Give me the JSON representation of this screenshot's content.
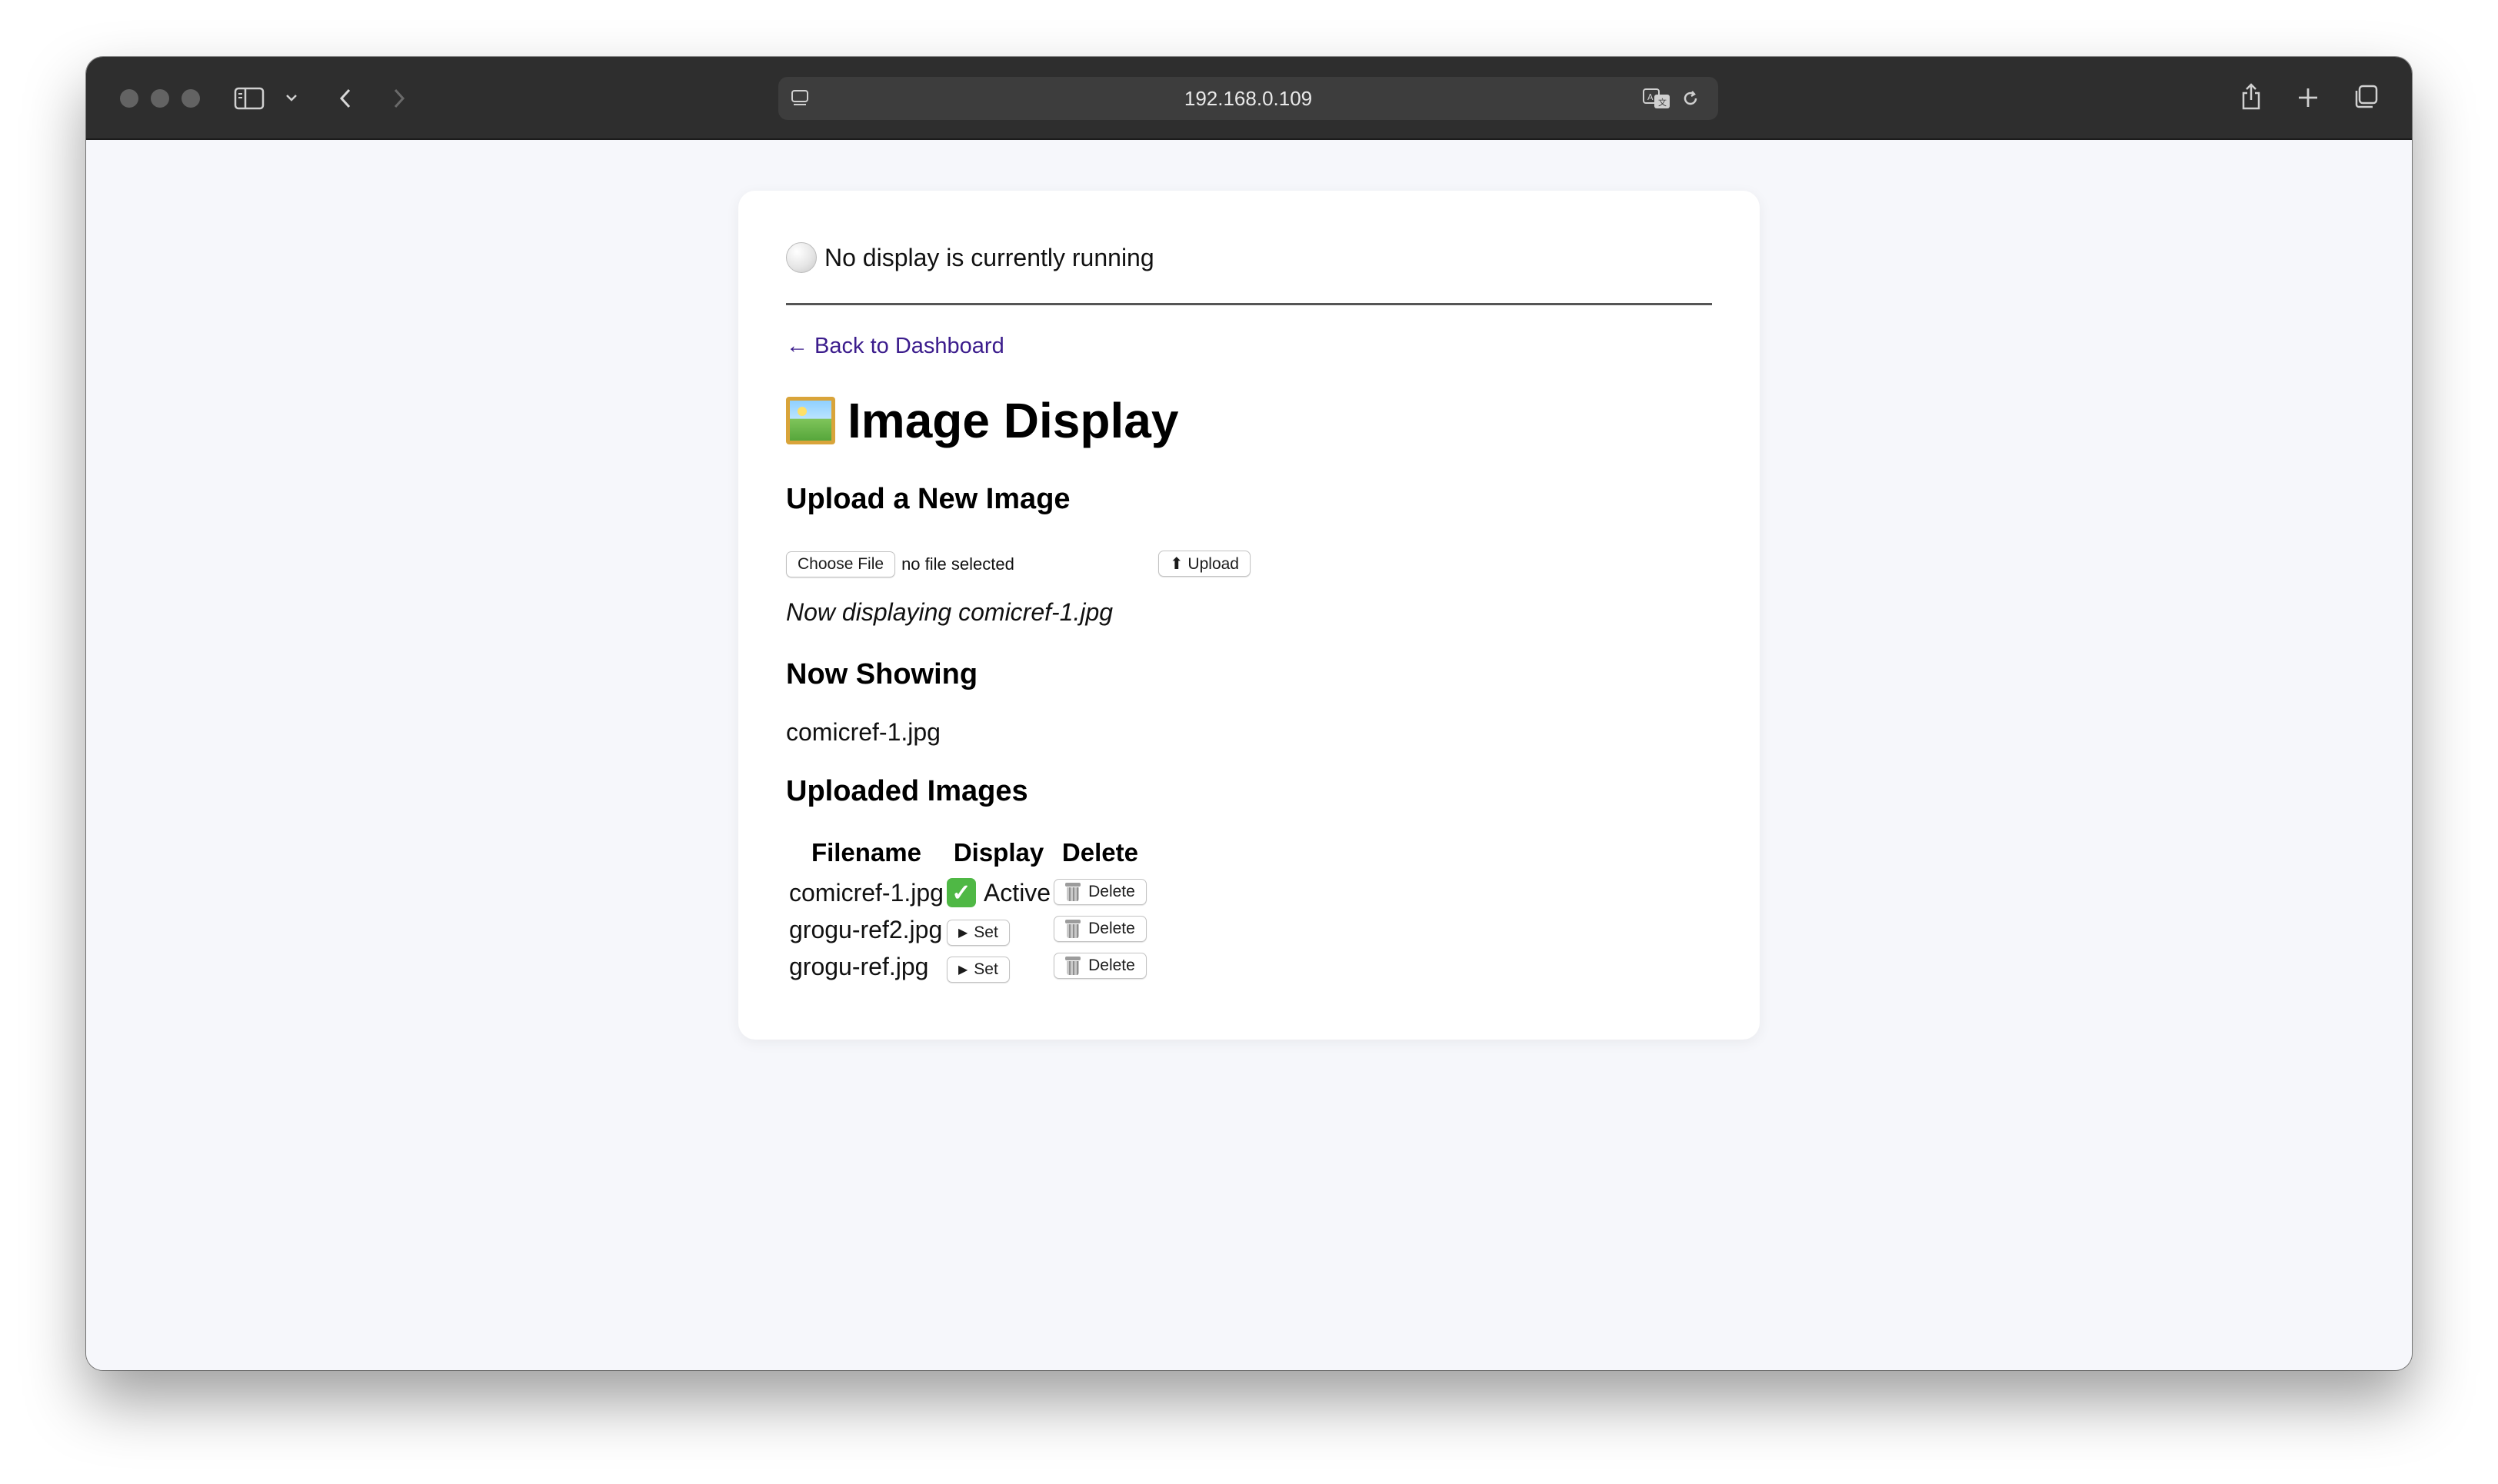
{
  "browser": {
    "url": "192.168.0.109"
  },
  "status": {
    "icon": "white-circle-icon",
    "text": "No display is currently running"
  },
  "nav": {
    "back_link": "← Back to Dashboard"
  },
  "page": {
    "title": "Image Display",
    "title_icon": "framed-picture-icon"
  },
  "upload": {
    "heading": "Upload a New Image",
    "choose_file_label": "Choose File",
    "no_file_text": "no file selected",
    "upload_button": "⬆ Upload",
    "message": "Now displaying comicref-1.jpg"
  },
  "now_showing": {
    "heading": "Now Showing",
    "filename": "comicref-1.jpg"
  },
  "uploaded": {
    "heading": "Uploaded Images",
    "columns": [
      "Filename",
      "Display",
      "Delete"
    ],
    "rows": [
      {
        "filename": "comicref-1.jpg",
        "display": "Active",
        "active": true,
        "delete": "Delete"
      },
      {
        "filename": "grogu-ref2.jpg",
        "display": "Set",
        "active": false,
        "delete": "Delete"
      },
      {
        "filename": "grogu-ref.jpg",
        "display": "Set",
        "active": false,
        "delete": "Delete"
      }
    ]
  },
  "colors": {
    "link": "#3b1c8c",
    "active_check": "#4fb845",
    "toolbar": "#2e2e2e"
  }
}
